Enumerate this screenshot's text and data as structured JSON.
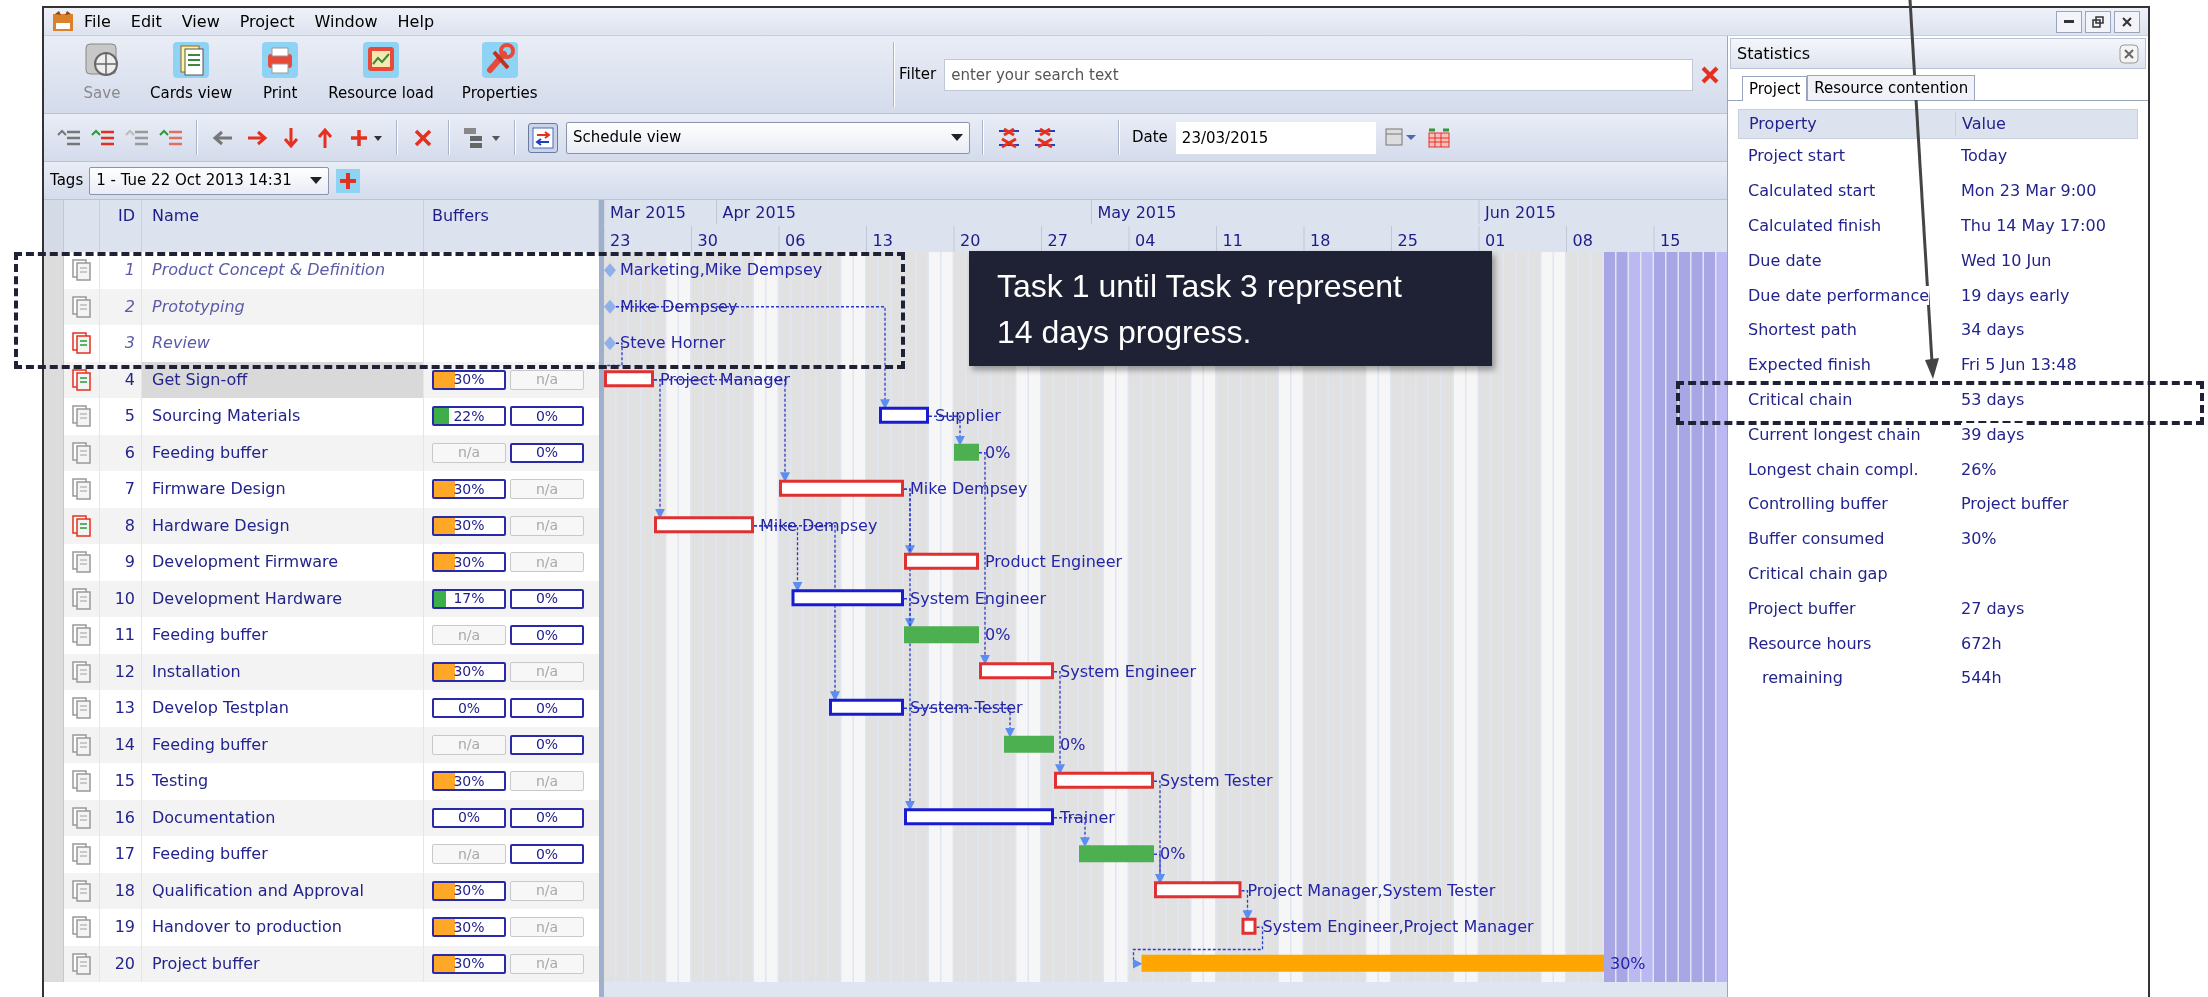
{
  "window": {
    "menu": [
      "File",
      "Edit",
      "View",
      "Project",
      "Window",
      "Help"
    ]
  },
  "toolbar": {
    "buttons": [
      {
        "label": "Save",
        "disabled": true
      },
      {
        "label": "Cards view",
        "disabled": false
      },
      {
        "label": "Print",
        "disabled": false
      },
      {
        "label": "Resource load",
        "disabled": false
      },
      {
        "label": "Properties",
        "disabled": false
      }
    ],
    "filter": {
      "label": "Filter",
      "placeholder": "enter your search text"
    }
  },
  "toolbar2": {
    "toggle": {
      "on": true
    },
    "view": "Schedule view",
    "date_label": "Date",
    "date": "23/03/2015"
  },
  "tags": {
    "label": "Tags",
    "value": "1 - Tue 22 Oct 2013 14:31"
  },
  "table": {
    "columns": [
      "ID",
      "Name",
      "Buffers"
    ],
    "rows": [
      {
        "id": "1",
        "name": "Product Concept & Definition",
        "completed": true,
        "flagged": false,
        "selected": false,
        "bar": {
          "kind": "milestone",
          "label": "Marketing,Mike Dempsey"
        }
      },
      {
        "id": "2",
        "name": "Prototyping",
        "completed": true,
        "flagged": false,
        "selected": false,
        "bar": {
          "kind": "milestone",
          "label": "Mike Dempsey"
        }
      },
      {
        "id": "3",
        "name": "Review",
        "completed": true,
        "flagged": true,
        "selected": false,
        "bar": {
          "kind": "milestone",
          "label": "Steve Horner"
        }
      },
      {
        "id": "4",
        "name": "Get Sign-off",
        "completed": false,
        "flagged": true,
        "selected": true,
        "buffers": [
          {
            "text": "30%",
            "level": 0.3,
            "color": "#ffa726",
            "disabled": false
          },
          {
            "text": "n/a",
            "disabled": true
          }
        ],
        "bar": {
          "kind": "task",
          "critical": true,
          "label": "Project Manager"
        }
      },
      {
        "id": "5",
        "name": "Sourcing Materials",
        "completed": false,
        "flagged": false,
        "selected": false,
        "buffers": [
          {
            "text": "22%",
            "level": 0.22,
            "color": "#3cae4a",
            "disabled": false
          },
          {
            "text": "0%",
            "disabled": false
          }
        ],
        "bar": {
          "kind": "task",
          "critical": false,
          "label": "Supplier"
        }
      },
      {
        "id": "6",
        "name": "Feeding buffer",
        "completed": false,
        "flagged": false,
        "selected": false,
        "buffers": [
          {
            "text": "n/a",
            "disabled": true
          },
          {
            "text": "0%",
            "disabled": false
          }
        ],
        "bar": {
          "kind": "buffer",
          "color": "#4caf50",
          "label": "0%"
        }
      },
      {
        "id": "7",
        "name": "Firmware Design",
        "completed": false,
        "flagged": false,
        "selected": false,
        "buffers": [
          {
            "text": "30%",
            "level": 0.3,
            "color": "#ffa726",
            "disabled": false
          },
          {
            "text": "n/a",
            "disabled": true
          }
        ],
        "bar": {
          "kind": "task",
          "critical": true,
          "label": "Mike Dempsey"
        }
      },
      {
        "id": "8",
        "name": "Hardware Design",
        "completed": false,
        "flagged": true,
        "selected": false,
        "buffers": [
          {
            "text": "30%",
            "level": 0.3,
            "color": "#ffa726",
            "disabled": false
          },
          {
            "text": "n/a",
            "disabled": true
          }
        ],
        "bar": {
          "kind": "task",
          "critical": true,
          "label": "Mike Dempsey"
        }
      },
      {
        "id": "9",
        "name": "Development Firmware",
        "completed": false,
        "flagged": false,
        "selected": false,
        "buffers": [
          {
            "text": "30%",
            "level": 0.3,
            "color": "#ffa726",
            "disabled": false
          },
          {
            "text": "n/a",
            "disabled": true
          }
        ],
        "bar": {
          "kind": "task",
          "critical": true,
          "label": "Product Engineer"
        }
      },
      {
        "id": "10",
        "name": "Development Hardware",
        "completed": false,
        "flagged": false,
        "selected": false,
        "buffers": [
          {
            "text": "17%",
            "level": 0.17,
            "color": "#3cae4a",
            "disabled": false
          },
          {
            "text": "0%",
            "disabled": false
          }
        ],
        "bar": {
          "kind": "task",
          "critical": false,
          "label": "System Engineer"
        }
      },
      {
        "id": "11",
        "name": "Feeding buffer",
        "completed": false,
        "flagged": false,
        "selected": false,
        "buffers": [
          {
            "text": "n/a",
            "disabled": true
          },
          {
            "text": "0%",
            "disabled": false
          }
        ],
        "bar": {
          "kind": "buffer",
          "color": "#4caf50",
          "label": "0%"
        }
      },
      {
        "id": "12",
        "name": "Installation",
        "completed": false,
        "flagged": false,
        "selected": false,
        "buffers": [
          {
            "text": "30%",
            "level": 0.3,
            "color": "#ffa726",
            "disabled": false
          },
          {
            "text": "n/a",
            "disabled": true
          }
        ],
        "bar": {
          "kind": "task",
          "critical": true,
          "label": "System Engineer"
        }
      },
      {
        "id": "13",
        "name": "Develop Testplan",
        "completed": false,
        "flagged": false,
        "selected": false,
        "buffers": [
          {
            "text": "0%",
            "disabled": false
          },
          {
            "text": "0%",
            "disabled": false
          }
        ],
        "bar": {
          "kind": "task",
          "critical": false,
          "label": "System Tester"
        }
      },
      {
        "id": "14",
        "name": "Feeding buffer",
        "completed": false,
        "flagged": false,
        "selected": false,
        "buffers": [
          {
            "text": "n/a",
            "disabled": true
          },
          {
            "text": "0%",
            "disabled": false
          }
        ],
        "bar": {
          "kind": "buffer",
          "color": "#4caf50",
          "label": "0%"
        }
      },
      {
        "id": "15",
        "name": "Testing",
        "completed": false,
        "flagged": false,
        "selected": false,
        "buffers": [
          {
            "text": "30%",
            "level": 0.3,
            "color": "#ffa726",
            "disabled": false
          },
          {
            "text": "n/a",
            "disabled": true
          }
        ],
        "bar": {
          "kind": "task",
          "critical": true,
          "label": "System Tester"
        }
      },
      {
        "id": "16",
        "name": "Documentation",
        "completed": false,
        "flagged": false,
        "selected": false,
        "buffers": [
          {
            "text": "0%",
            "disabled": false
          },
          {
            "text": "0%",
            "disabled": false
          }
        ],
        "bar": {
          "kind": "task",
          "critical": false,
          "label": "Trainer"
        }
      },
      {
        "id": "17",
        "name": "Feeding buffer",
        "completed": false,
        "flagged": false,
        "selected": false,
        "buffers": [
          {
            "text": "n/a",
            "disabled": true
          },
          {
            "text": "0%",
            "disabled": false
          }
        ],
        "bar": {
          "kind": "buffer",
          "color": "#4caf50",
          "label": "0%"
        }
      },
      {
        "id": "18",
        "name": "Qualification and Approval",
        "completed": false,
        "flagged": false,
        "selected": false,
        "buffers": [
          {
            "text": "30%",
            "level": 0.3,
            "color": "#ffa726",
            "disabled": false
          },
          {
            "text": "n/a",
            "disabled": true
          }
        ],
        "bar": {
          "kind": "task",
          "critical": true,
          "label": "Project Manager,System Tester"
        }
      },
      {
        "id": "19",
        "name": "Handover to production",
        "completed": false,
        "flagged": false,
        "selected": false,
        "buffers": [
          {
            "text": "30%",
            "level": 0.3,
            "color": "#ffa726",
            "disabled": false
          },
          {
            "text": "n/a",
            "disabled": true
          }
        ],
        "bar": {
          "kind": "task",
          "critical": true,
          "label": "System Engineer,Project Manager"
        }
      },
      {
        "id": "20",
        "name": "Project buffer",
        "completed": false,
        "flagged": false,
        "selected": false,
        "buffers": [
          {
            "text": "30%",
            "level": 0.3,
            "color": "#ffa726",
            "disabled": false
          },
          {
            "text": "n/a",
            "disabled": true
          }
        ],
        "bar": {
          "kind": "buffer",
          "color": "#ffa500",
          "label": "30%"
        }
      }
    ]
  },
  "gantt": {
    "months": [
      "Mar 2015",
      "Apr 2015",
      "May 2015",
      "Jun 2015"
    ],
    "weeks": [
      "23",
      "30",
      "06",
      "13",
      "20",
      "27",
      "04",
      "11",
      "18",
      "25",
      "01",
      "08",
      "15"
    ]
  },
  "statistics": {
    "title": "Statistics",
    "tabs": [
      {
        "label": "Project",
        "selected": true
      },
      {
        "label": "Resource contention",
        "selected": false
      }
    ],
    "columns": [
      "Property",
      "Value"
    ],
    "rows": [
      {
        "property": "Project start",
        "value": "Today"
      },
      {
        "property": "Calculated start",
        "value": "Mon 23 Mar 9:00"
      },
      {
        "property": "Calculated finish",
        "value": "Thu 14 May 17:00"
      },
      {
        "property": "Due date",
        "value": "Wed 10 Jun"
      },
      {
        "property": "Due date performance",
        "value": "19 days early"
      },
      {
        "property": "Shortest path",
        "value": "34 days"
      },
      {
        "property": "Expected finish",
        "value": "Fri 5 Jun 13:48"
      },
      {
        "property": "Critical chain",
        "value": "53 days"
      },
      {
        "property": "Current longest chain",
        "value": "39 days"
      },
      {
        "property": "Longest chain compl.",
        "value": "26%"
      },
      {
        "property": "Controlling buffer",
        "value": "Project buffer"
      },
      {
        "property": "Buffer consumed",
        "value": "30%"
      },
      {
        "property": "Critical chain gap"
      },
      {
        "property": "Project buffer",
        "value": "27 days"
      },
      {
        "property": "Resource hours",
        "value": "672h",
        "children": [
          {
            "property": "remaining",
            "value": "544h"
          }
        ]
      }
    ]
  },
  "annotation": {
    "callout": "Task 1 until Task 3 represent\n14 days progress."
  }
}
